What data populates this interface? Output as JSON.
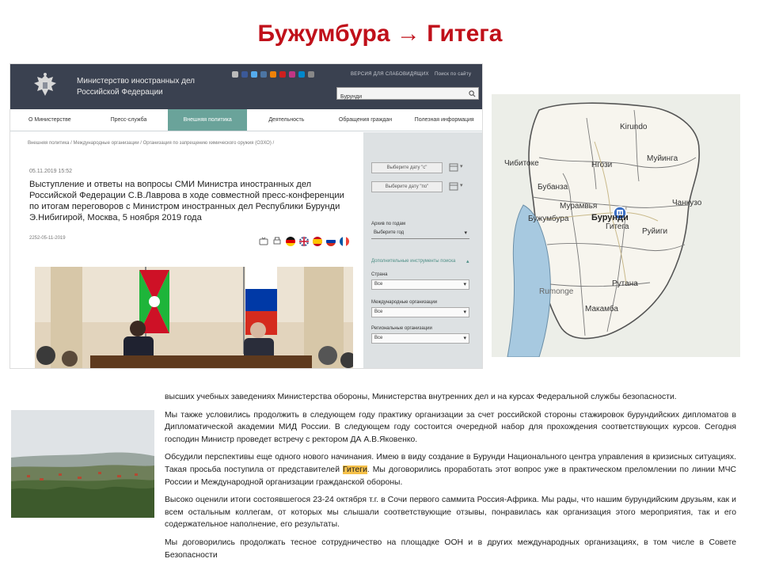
{
  "slide": {
    "title": "Бужумбура → Гитега"
  },
  "site": {
    "ministry_name_line1": "Министерство иностранных дел",
    "ministry_name_line2": "Российской Федерации",
    "header_link_1": "ВЕРСИЯ ДЛЯ СЛАБОВИДЯЩИХ",
    "header_link_2": "Поиск по сайту",
    "search": {
      "value": "Бурунди",
      "placeholder": ""
    },
    "nav": [
      "О Министерстве",
      "Пресс-служба",
      "Внешняя политика",
      "Деятельность",
      "Обращения граждан",
      "Полезная информация"
    ],
    "breadcrumb": "Внешняя политика / Международные организации / Организация по запрещению химического оружия (ОЗХО) /",
    "article": {
      "date": "05.11.2019 15:52",
      "title": "Выступление и ответы на вопросы СМИ Министра иностранных дел Российской Федерации С.В.Лаврова в ходе совместной пресс-конференции по итогам переговоров с Министром иностранных дел Республики Бурунди Э.Нибигирой, Москва, 5 ноября 2019 года",
      "views": "2252-05-11-2019"
    },
    "sidebar": {
      "date_from": "Выберите дату \"с\"",
      "date_to": "Выберите дату \"по\"",
      "archive_label": "Архив по годам",
      "archive_value": "Выберите год",
      "extra_tools": "Дополнительные инструменты поиска",
      "country_label": "Страна",
      "country_value": "Все",
      "intl_org_label": "Международные организации",
      "intl_org_value": "Все",
      "regional_org_label": "Региональные организации",
      "regional_org_value": "Все"
    }
  },
  "map": {
    "labels": {
      "kirundo": "Kirundo",
      "chibitoke": "Чибитоке",
      "ngozi": "Нгози",
      "muyinga": "Муйинга",
      "bubanza": "Бубанза",
      "muramvya": "Мурамвья",
      "bujumbura": "Бужумбура",
      "burundi": "Бурунди",
      "gitega": "Гитега",
      "cankuzo": "Чанкузо",
      "ruyigi": "Руйиги",
      "rumonge": "Rumonge",
      "rutana": "Рутана",
      "makamba": "Макамба"
    }
  },
  "excerpt": {
    "p1": "высших учебных заведениях Министерства обороны, Министерства внутренних дел и на курсах Федеральной службы безопасности.",
    "p2": "Мы также условились продолжить в следующем году практику организации за счет российской стороны стажировок бурундийских дипломатов в Дипломатической академии МИД России. В следующем году состоится очередной набор для прохождения соответствующих курсов. Сегодня господин Министр проведет встречу с ректором ДА А.В.Яковенко.",
    "p3a": "Обсудили перспективы еще одного нового начинания. Имею в виду создание в Бурунди Национального центра управления в кризисных ситуациях. Такая просьба поступила от представителей",
    "p3_highlight": "Гитеги",
    "p3b": ". Мы договорились проработать этот вопрос уже в практическом преломлении по линии МЧС России и Международной организации гражданской обороны.",
    "p4": "Высоко оценили итоги состоявшегося 23-24 октября т.г. в Сочи первого саммита Россия-Африка. Мы рады, что нашим бурундийским друзьям, как и всем остальным коллегам, от которых мы слышали соответствующие отзывы, понравилась как организация этого мероприятия, так и его содержательное наполнение, его результаты.",
    "p5": "Мы договорились продолжать тесное сотрудничество на площадке ООН и в других международных организациях, в том числе в Совете Безопасности"
  }
}
